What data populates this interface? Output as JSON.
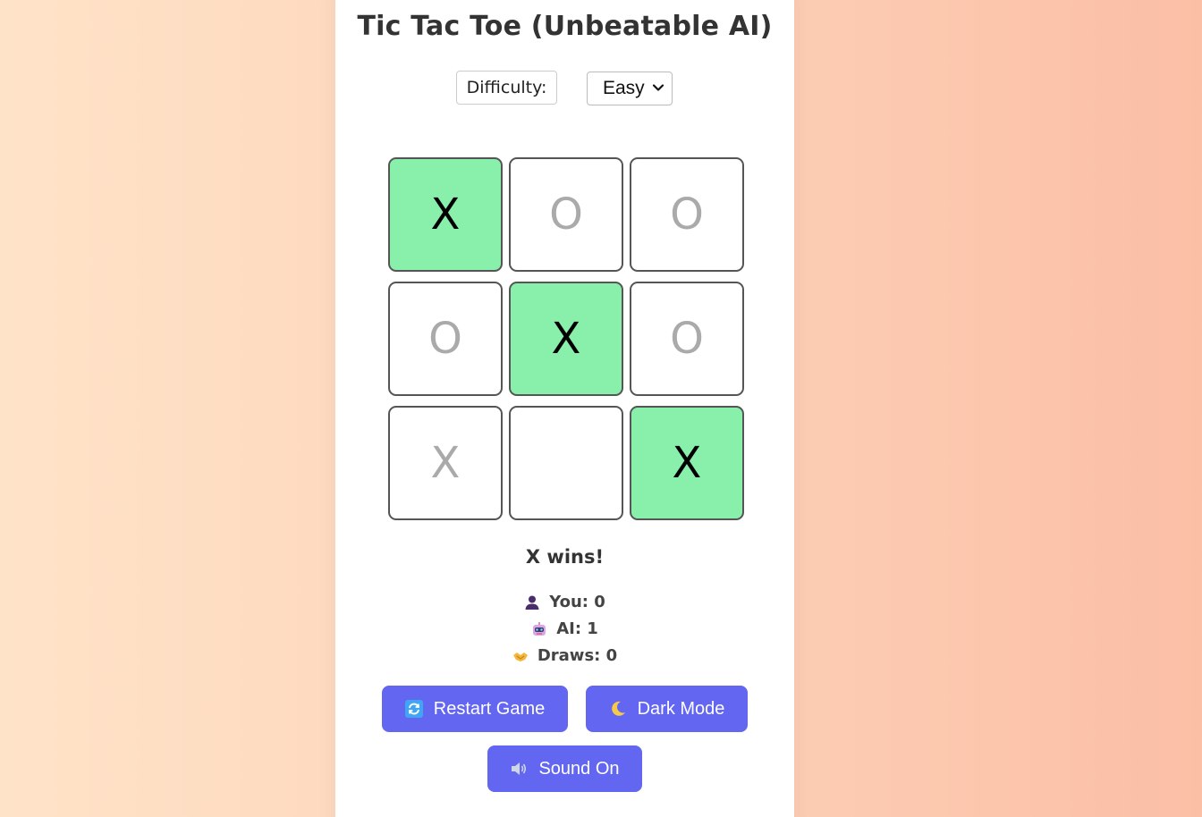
{
  "title": "Tic Tac Toe (Unbeatable AI)",
  "difficulty": {
    "label": "Difficulty:",
    "selected": "Easy"
  },
  "board": {
    "cells": [
      {
        "mark": "X",
        "state": "win"
      },
      {
        "mark": "O",
        "state": "faded"
      },
      {
        "mark": "O",
        "state": "faded"
      },
      {
        "mark": "O",
        "state": "faded"
      },
      {
        "mark": "X",
        "state": "win"
      },
      {
        "mark": "O",
        "state": "faded"
      },
      {
        "mark": "X",
        "state": "faded"
      },
      {
        "mark": "",
        "state": "empty"
      },
      {
        "mark": "X",
        "state": "win"
      }
    ],
    "win_color": "#88f0aa"
  },
  "status": "X wins!",
  "score": {
    "you": "You: 0",
    "ai": "AI: 1",
    "draws": "Draws: 0"
  },
  "buttons": {
    "restart": "Restart Game",
    "dark_mode": "Dark Mode",
    "sound": "Sound On"
  },
  "icons": {
    "you": "user-icon",
    "ai": "robot-icon",
    "draws": "handshake-icon",
    "restart": "refresh-icon",
    "dark_mode": "moon-icon",
    "sound": "speaker-icon"
  },
  "accent_color": "#6366f1"
}
